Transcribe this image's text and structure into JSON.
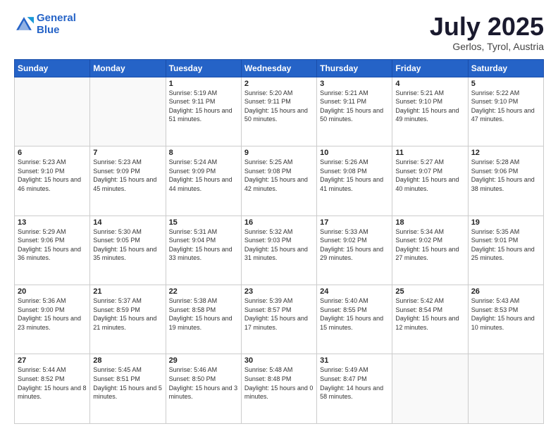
{
  "header": {
    "logo_line1": "General",
    "logo_line2": "Blue",
    "title": "July 2025",
    "location": "Gerlos, Tyrol, Austria"
  },
  "weekdays": [
    "Sunday",
    "Monday",
    "Tuesday",
    "Wednesday",
    "Thursday",
    "Friday",
    "Saturday"
  ],
  "weeks": [
    [
      {
        "day": "",
        "sunrise": "",
        "sunset": "",
        "daylight": ""
      },
      {
        "day": "",
        "sunrise": "",
        "sunset": "",
        "daylight": ""
      },
      {
        "day": "1",
        "sunrise": "Sunrise: 5:19 AM",
        "sunset": "Sunset: 9:11 PM",
        "daylight": "Daylight: 15 hours and 51 minutes."
      },
      {
        "day": "2",
        "sunrise": "Sunrise: 5:20 AM",
        "sunset": "Sunset: 9:11 PM",
        "daylight": "Daylight: 15 hours and 50 minutes."
      },
      {
        "day": "3",
        "sunrise": "Sunrise: 5:21 AM",
        "sunset": "Sunset: 9:11 PM",
        "daylight": "Daylight: 15 hours and 50 minutes."
      },
      {
        "day": "4",
        "sunrise": "Sunrise: 5:21 AM",
        "sunset": "Sunset: 9:10 PM",
        "daylight": "Daylight: 15 hours and 49 minutes."
      },
      {
        "day": "5",
        "sunrise": "Sunrise: 5:22 AM",
        "sunset": "Sunset: 9:10 PM",
        "daylight": "Daylight: 15 hours and 47 minutes."
      }
    ],
    [
      {
        "day": "6",
        "sunrise": "Sunrise: 5:23 AM",
        "sunset": "Sunset: 9:10 PM",
        "daylight": "Daylight: 15 hours and 46 minutes."
      },
      {
        "day": "7",
        "sunrise": "Sunrise: 5:23 AM",
        "sunset": "Sunset: 9:09 PM",
        "daylight": "Daylight: 15 hours and 45 minutes."
      },
      {
        "day": "8",
        "sunrise": "Sunrise: 5:24 AM",
        "sunset": "Sunset: 9:09 PM",
        "daylight": "Daylight: 15 hours and 44 minutes."
      },
      {
        "day": "9",
        "sunrise": "Sunrise: 5:25 AM",
        "sunset": "Sunset: 9:08 PM",
        "daylight": "Daylight: 15 hours and 42 minutes."
      },
      {
        "day": "10",
        "sunrise": "Sunrise: 5:26 AM",
        "sunset": "Sunset: 9:08 PM",
        "daylight": "Daylight: 15 hours and 41 minutes."
      },
      {
        "day": "11",
        "sunrise": "Sunrise: 5:27 AM",
        "sunset": "Sunset: 9:07 PM",
        "daylight": "Daylight: 15 hours and 40 minutes."
      },
      {
        "day": "12",
        "sunrise": "Sunrise: 5:28 AM",
        "sunset": "Sunset: 9:06 PM",
        "daylight": "Daylight: 15 hours and 38 minutes."
      }
    ],
    [
      {
        "day": "13",
        "sunrise": "Sunrise: 5:29 AM",
        "sunset": "Sunset: 9:06 PM",
        "daylight": "Daylight: 15 hours and 36 minutes."
      },
      {
        "day": "14",
        "sunrise": "Sunrise: 5:30 AM",
        "sunset": "Sunset: 9:05 PM",
        "daylight": "Daylight: 15 hours and 35 minutes."
      },
      {
        "day": "15",
        "sunrise": "Sunrise: 5:31 AM",
        "sunset": "Sunset: 9:04 PM",
        "daylight": "Daylight: 15 hours and 33 minutes."
      },
      {
        "day": "16",
        "sunrise": "Sunrise: 5:32 AM",
        "sunset": "Sunset: 9:03 PM",
        "daylight": "Daylight: 15 hours and 31 minutes."
      },
      {
        "day": "17",
        "sunrise": "Sunrise: 5:33 AM",
        "sunset": "Sunset: 9:02 PM",
        "daylight": "Daylight: 15 hours and 29 minutes."
      },
      {
        "day": "18",
        "sunrise": "Sunrise: 5:34 AM",
        "sunset": "Sunset: 9:02 PM",
        "daylight": "Daylight: 15 hours and 27 minutes."
      },
      {
        "day": "19",
        "sunrise": "Sunrise: 5:35 AM",
        "sunset": "Sunset: 9:01 PM",
        "daylight": "Daylight: 15 hours and 25 minutes."
      }
    ],
    [
      {
        "day": "20",
        "sunrise": "Sunrise: 5:36 AM",
        "sunset": "Sunset: 9:00 PM",
        "daylight": "Daylight: 15 hours and 23 minutes."
      },
      {
        "day": "21",
        "sunrise": "Sunrise: 5:37 AM",
        "sunset": "Sunset: 8:59 PM",
        "daylight": "Daylight: 15 hours and 21 minutes."
      },
      {
        "day": "22",
        "sunrise": "Sunrise: 5:38 AM",
        "sunset": "Sunset: 8:58 PM",
        "daylight": "Daylight: 15 hours and 19 minutes."
      },
      {
        "day": "23",
        "sunrise": "Sunrise: 5:39 AM",
        "sunset": "Sunset: 8:57 PM",
        "daylight": "Daylight: 15 hours and 17 minutes."
      },
      {
        "day": "24",
        "sunrise": "Sunrise: 5:40 AM",
        "sunset": "Sunset: 8:55 PM",
        "daylight": "Daylight: 15 hours and 15 minutes."
      },
      {
        "day": "25",
        "sunrise": "Sunrise: 5:42 AM",
        "sunset": "Sunset: 8:54 PM",
        "daylight": "Daylight: 15 hours and 12 minutes."
      },
      {
        "day": "26",
        "sunrise": "Sunrise: 5:43 AM",
        "sunset": "Sunset: 8:53 PM",
        "daylight": "Daylight: 15 hours and 10 minutes."
      }
    ],
    [
      {
        "day": "27",
        "sunrise": "Sunrise: 5:44 AM",
        "sunset": "Sunset: 8:52 PM",
        "daylight": "Daylight: 15 hours and 8 minutes."
      },
      {
        "day": "28",
        "sunrise": "Sunrise: 5:45 AM",
        "sunset": "Sunset: 8:51 PM",
        "daylight": "Daylight: 15 hours and 5 minutes."
      },
      {
        "day": "29",
        "sunrise": "Sunrise: 5:46 AM",
        "sunset": "Sunset: 8:50 PM",
        "daylight": "Daylight: 15 hours and 3 minutes."
      },
      {
        "day": "30",
        "sunrise": "Sunrise: 5:48 AM",
        "sunset": "Sunset: 8:48 PM",
        "daylight": "Daylight: 15 hours and 0 minutes."
      },
      {
        "day": "31",
        "sunrise": "Sunrise: 5:49 AM",
        "sunset": "Sunset: 8:47 PM",
        "daylight": "Daylight: 14 hours and 58 minutes."
      },
      {
        "day": "",
        "sunrise": "",
        "sunset": "",
        "daylight": ""
      },
      {
        "day": "",
        "sunrise": "",
        "sunset": "",
        "daylight": ""
      }
    ]
  ]
}
